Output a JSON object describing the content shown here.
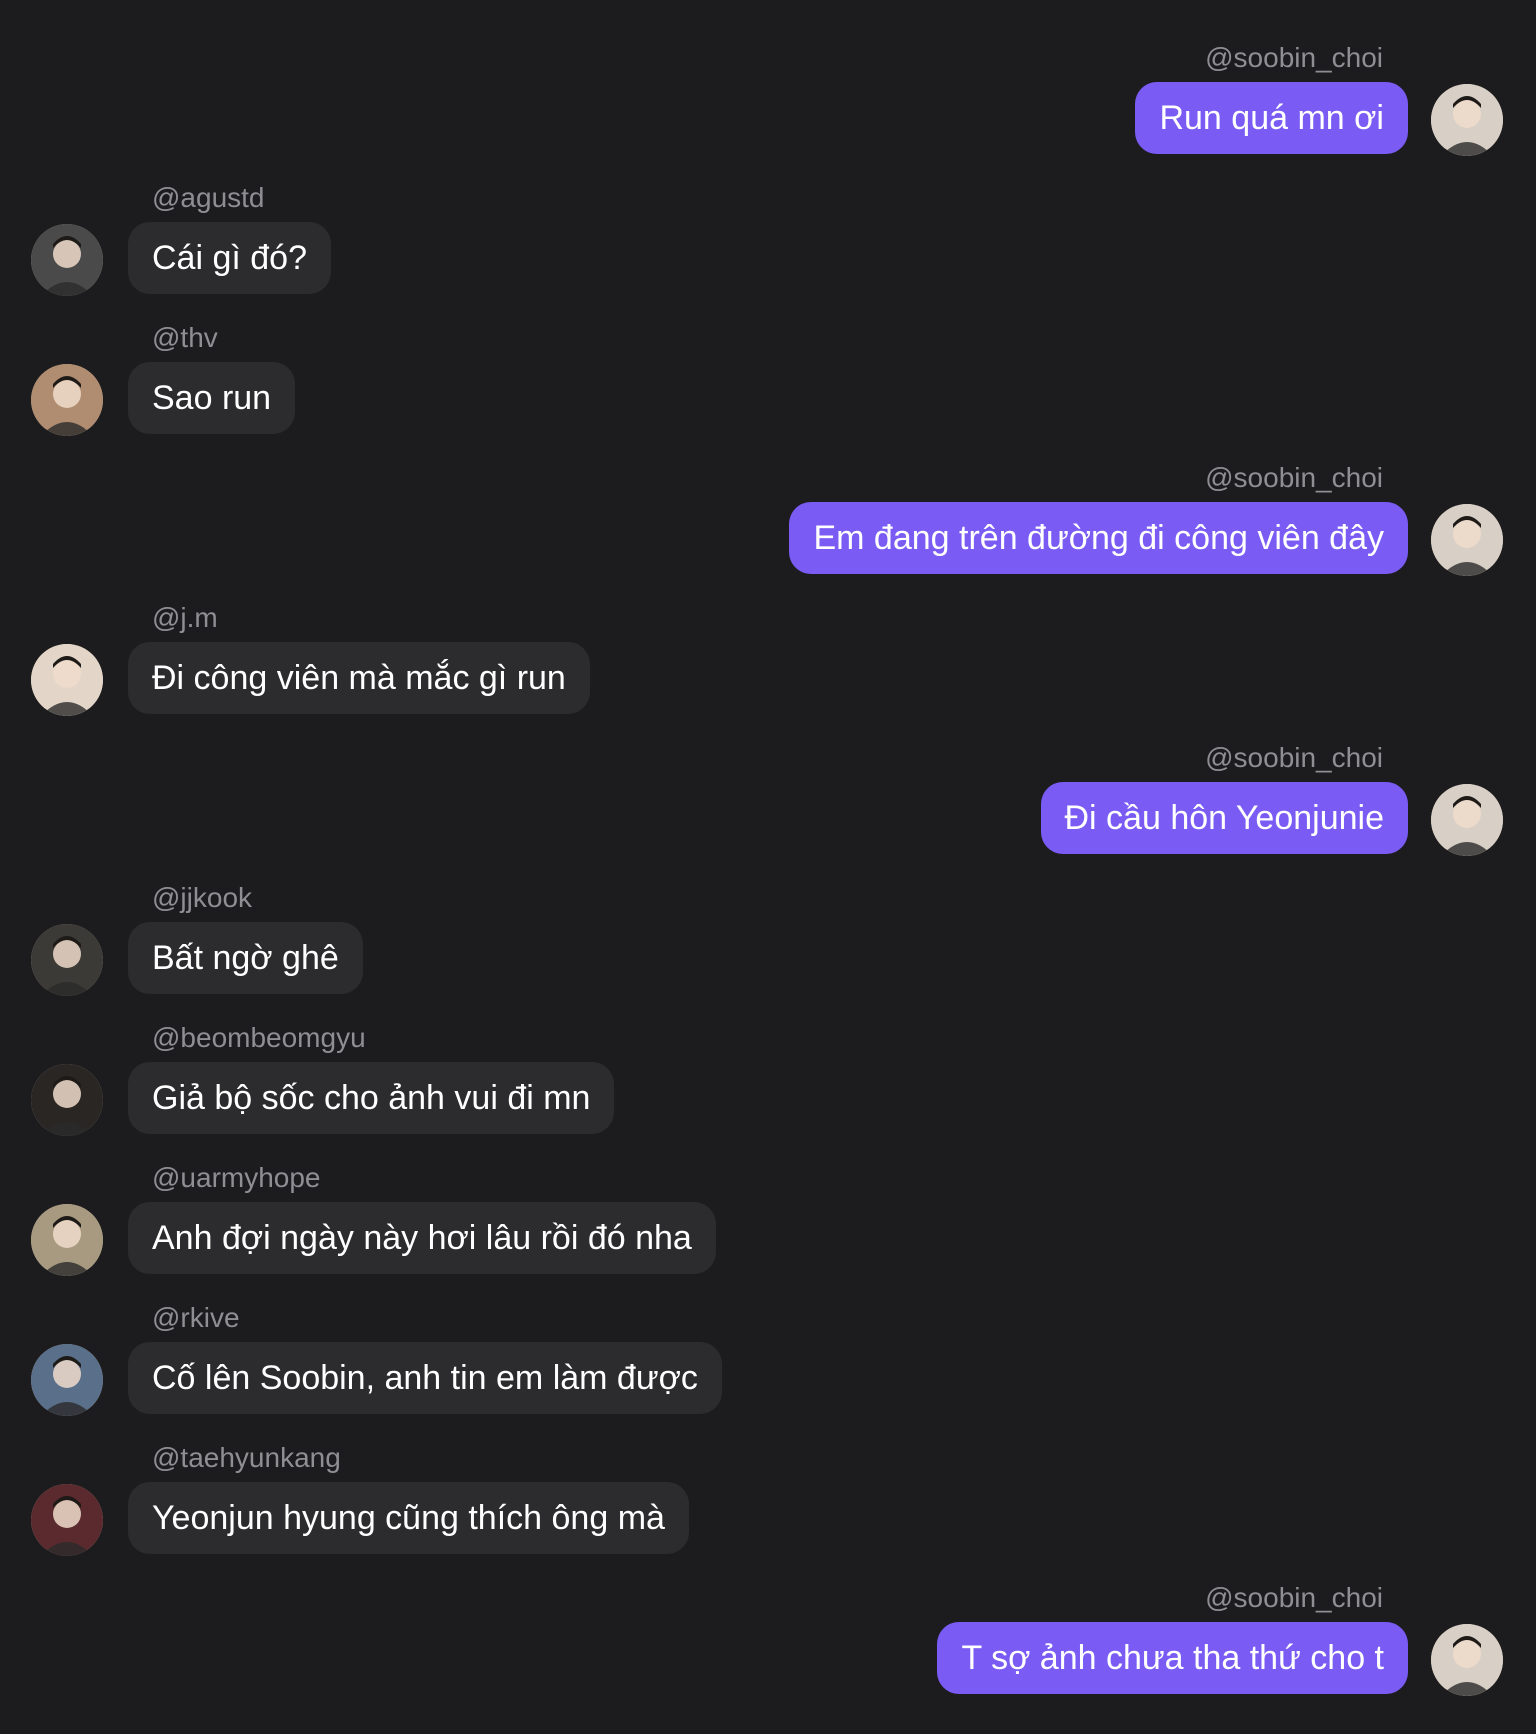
{
  "messages": [
    {
      "side": "out",
      "user": "@soobin_choi",
      "text": "Run quá mn ơi",
      "avatar": "soobin-avatar",
      "avatar_tone": "#d8cfc6"
    },
    {
      "side": "in",
      "user": "@agustd",
      "text": "Cái gì đó?",
      "avatar": "agustd-avatar",
      "avatar_tone": "#4a4a4a"
    },
    {
      "side": "in",
      "user": "@thv",
      "text": "Sao run",
      "avatar": "thv-avatar",
      "avatar_tone": "#b08c70"
    },
    {
      "side": "out",
      "user": "@soobin_choi",
      "text": "Em đang trên đường đi công viên đây",
      "avatar": "soobin-avatar",
      "avatar_tone": "#d8cfc6"
    },
    {
      "side": "in",
      "user": "@j.m",
      "text": "Đi công viên mà mắc gì run",
      "avatar": "jm-avatar",
      "avatar_tone": "#e3d6c8"
    },
    {
      "side": "out",
      "user": "@soobin_choi",
      "text": "Đi cầu hôn Yeonjunie",
      "avatar": "soobin-avatar",
      "avatar_tone": "#d8cfc6"
    },
    {
      "side": "in",
      "user": "@jjkook",
      "text": "Bất ngờ ghê",
      "avatar": "jjkook-avatar",
      "avatar_tone": "#3b3a36"
    },
    {
      "side": "in",
      "user": "@beombeomgyu",
      "text": "Giả bộ sốc cho ảnh vui đi mn",
      "avatar": "beomgyu-avatar",
      "avatar_tone": "#2a2624"
    },
    {
      "side": "in",
      "user": "@uarmyhope",
      "text": "Anh đợi ngày này hơi lâu rồi đó nha",
      "avatar": "uarmyhope-avatar",
      "avatar_tone": "#a89a80"
    },
    {
      "side": "in",
      "user": "@rkive",
      "text": "Cố lên Soobin, anh tin em làm được",
      "avatar": "rkive-avatar",
      "avatar_tone": "#5a6f8a"
    },
    {
      "side": "in",
      "user": "@taehyunkang",
      "text": "Yeonjun hyung cũng thích ông mà",
      "avatar": "taehyun-avatar",
      "avatar_tone": "#5a2a2e"
    },
    {
      "side": "out",
      "user": "@soobin_choi",
      "text": "T sợ ảnh chưa tha thứ cho t",
      "avatar": "soobin-avatar",
      "avatar_tone": "#d8cfc6"
    }
  ],
  "colors": {
    "background": "#1c1c1e",
    "incoming_bubble": "#2c2c2e",
    "outgoing_bubble": "#7a5cf5",
    "username": "#8e8e93"
  }
}
